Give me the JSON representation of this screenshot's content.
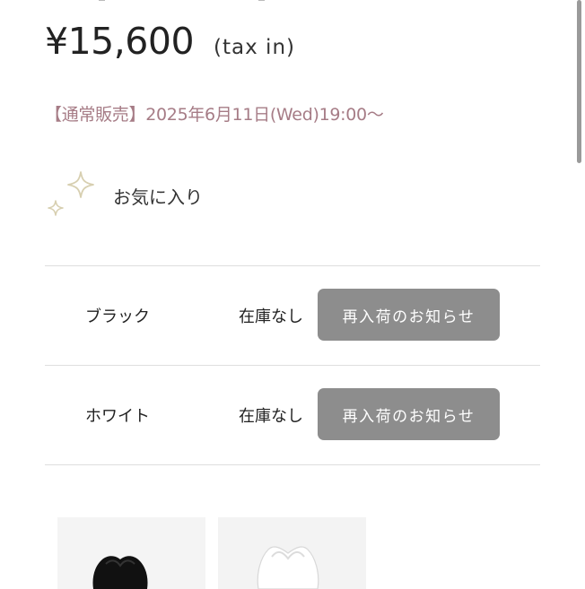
{
  "product": {
    "price": "¥15,600",
    "tax_note": "(tax in)",
    "sale_info": "【通常販売】2025年6月11日(Wed)19:00〜"
  },
  "favorite": {
    "label": "お気に入り",
    "icon": "sparkle-icon"
  },
  "variants": [
    {
      "name": "ブラック",
      "stock": "在庫なし",
      "button_label": "再入荷のお知らせ"
    },
    {
      "name": "ホワイト",
      "stock": "在庫なし",
      "button_label": "再入荷のお知らせ"
    }
  ],
  "thumbnails": [
    {
      "color": "black"
    },
    {
      "color": "white"
    }
  ],
  "colors": {
    "sale_text": "#a67c86",
    "button_bg": "#8d8d8d",
    "sparkle": "#d7cfb0"
  }
}
